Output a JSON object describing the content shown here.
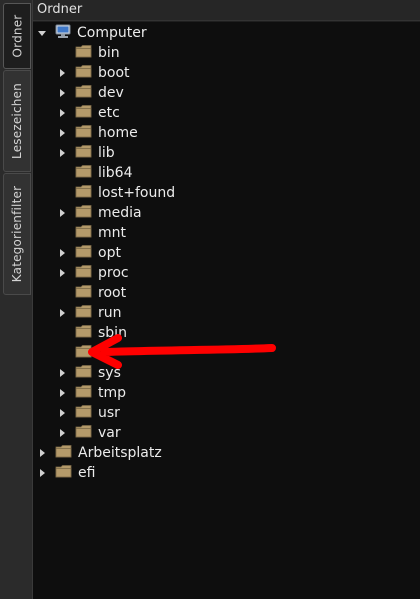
{
  "sidebar_tabs": [
    {
      "label": "Ordner",
      "active": true
    },
    {
      "label": "Lesezeichen",
      "active": false
    },
    {
      "label": "Kategorienfilter",
      "active": false
    }
  ],
  "panel": {
    "title": "Ordner"
  },
  "tree": {
    "root": {
      "label": "Computer",
      "icon": "computer-icon",
      "expanded": true
    },
    "children": [
      {
        "label": "bin",
        "expandable": false
      },
      {
        "label": "boot",
        "expandable": true
      },
      {
        "label": "dev",
        "expandable": true
      },
      {
        "label": "etc",
        "expandable": true
      },
      {
        "label": "home",
        "expandable": true
      },
      {
        "label": "lib",
        "expandable": true
      },
      {
        "label": "lib64",
        "expandable": false
      },
      {
        "label": "lost+found",
        "expandable": false
      },
      {
        "label": "media",
        "expandable": true
      },
      {
        "label": "mnt",
        "expandable": false
      },
      {
        "label": "opt",
        "expandable": true
      },
      {
        "label": "proc",
        "expandable": true
      },
      {
        "label": "root",
        "expandable": false
      },
      {
        "label": "run",
        "expandable": true
      },
      {
        "label": "sbin",
        "expandable": false
      },
      {
        "label": "",
        "expandable": false
      },
      {
        "label": "sys",
        "expandable": true
      },
      {
        "label": "tmp",
        "expandable": true
      },
      {
        "label": "usr",
        "expandable": true
      },
      {
        "label": "var",
        "expandable": true
      }
    ],
    "top_level": [
      {
        "label": "Arbeitsplatz",
        "expandable": true
      },
      {
        "label": "efi",
        "expandable": true
      }
    ]
  },
  "colors": {
    "folder": "#b49a6a",
    "arrow_annotation": "#ff0000",
    "text": "#ececec"
  }
}
